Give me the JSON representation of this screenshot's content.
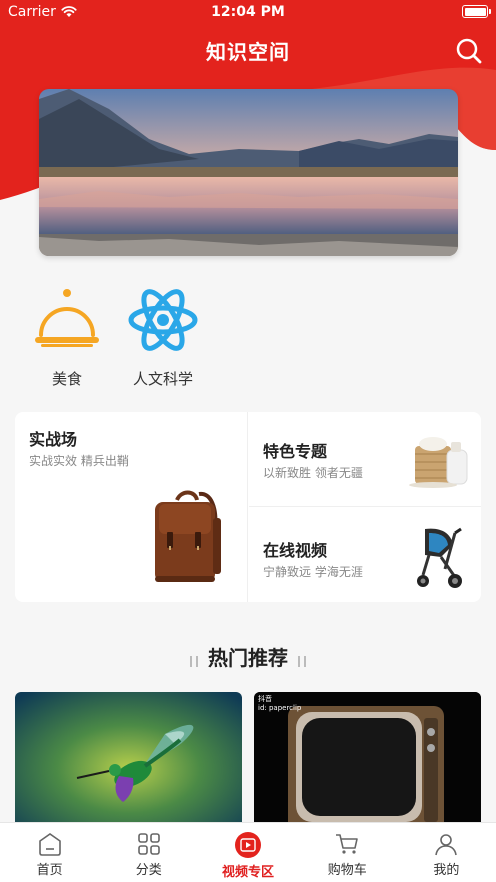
{
  "status_bar": {
    "carrier": "Carrier",
    "time": "12:04 PM"
  },
  "nav": {
    "title": "知识空间",
    "search_icon": "search-icon"
  },
  "banner": {
    "image": "mountain-lake-photo"
  },
  "categories": [
    {
      "label": "美食",
      "icon": "food-cloche-icon"
    },
    {
      "label": "人文科学",
      "icon": "atom-icon"
    }
  ],
  "feature_cards": {
    "main": {
      "title": "实战场",
      "subtitle": "实战实效 精兵出鞘",
      "image": "leather-backpack"
    },
    "top": {
      "title": "特色专题",
      "subtitle": "以新致胜 领者无疆",
      "image": "bamboo-basket"
    },
    "bottom": {
      "title": "在线视频",
      "subtitle": "宁静致远 学海无涯",
      "image": "baby-stroller"
    }
  },
  "section": {
    "title": "热门推荐"
  },
  "recommendations": [
    {
      "image": "hummingbird-photo"
    },
    {
      "image": "retro-tv-photo",
      "tag_line1": "抖音",
      "tag_line2": "id: paperclip"
    }
  ],
  "tab_bar": {
    "active": "视频专区",
    "items": [
      {
        "label": "首页",
        "icon": "home-icon"
      },
      {
        "label": "分类",
        "icon": "grid-icon"
      },
      {
        "label": "视频专区",
        "icon": "video-icon"
      },
      {
        "label": "购物车",
        "icon": "cart-icon"
      },
      {
        "label": "我的",
        "icon": "user-icon"
      }
    ]
  },
  "colors": {
    "brand_red": "#e3231d",
    "text_dark": "#222222",
    "text_muted": "#888888",
    "icon_orange": "#f5a623",
    "icon_blue": "#2aa7e8"
  }
}
